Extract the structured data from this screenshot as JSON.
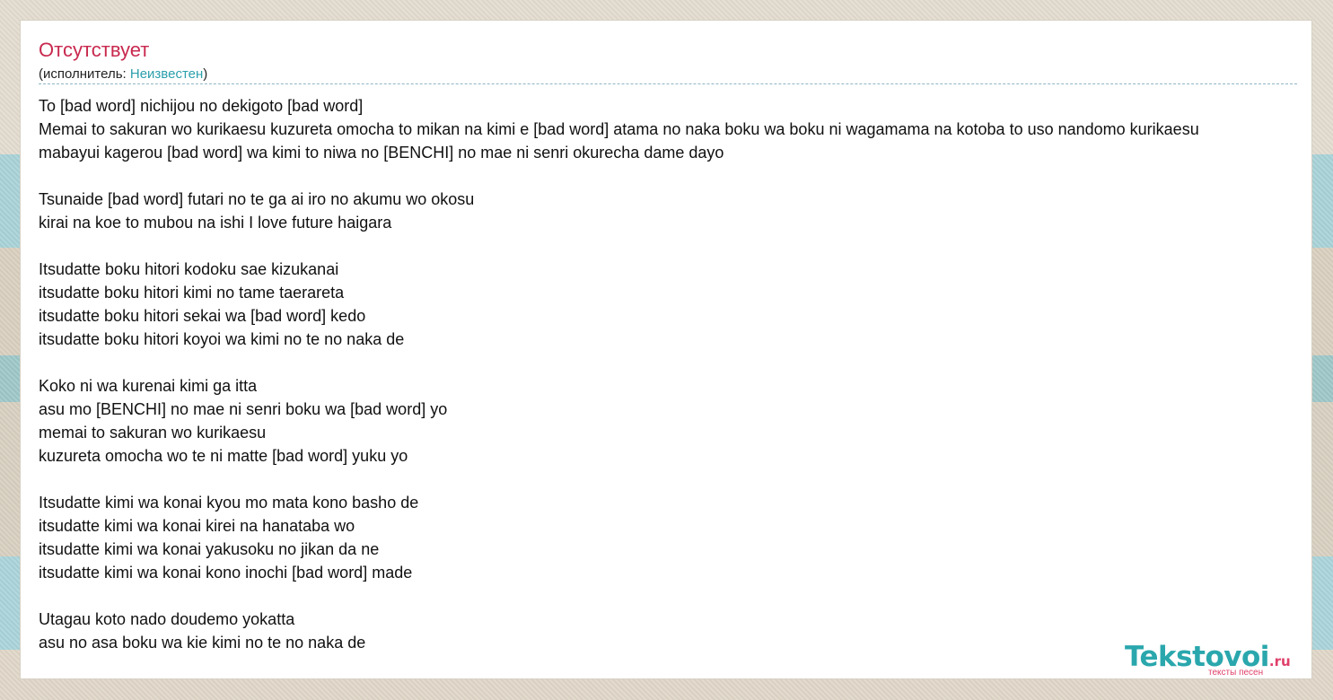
{
  "song": {
    "title": "Отсутствует",
    "artist_prefix": "(исполнитель: ",
    "artist": "Неизвестен",
    "artist_suffix": ")"
  },
  "lyrics": [
    "To [bad word] nichijou no dekigoto [bad word]",
    "Memai to sakuran wo kurikaesu kuzureta omocha to mikan na kimi e [bad word] atama no naka boku wa boku ni wagamama na kotoba to uso nandomo kurikaesu",
    "mabayui kagerou [bad word] wa kimi to niwa no [BENCHI] no mae ni senri okurecha dame dayo",
    "",
    "Tsunaide [bad word] futari no te ga ai iro no akumu wo okosu",
    "kirai na koe to mubou na ishi I love future haigara",
    "",
    "Itsudatte boku hitori kodoku sae kizukanai",
    "itsudatte boku hitori kimi no tame taerareta",
    "itsudatte boku hitori sekai wa [bad word] kedo",
    "itsudatte boku hitori koyoi wa kimi no te no naka de",
    "",
    "Koko ni wa kurenai kimi ga itta",
    "asu mo [BENCHI] no mae ni senri boku wa [bad word] yo",
    "memai to sakuran wo kurikaesu",
    "kuzureta omocha wo te ni matte [bad word] yuku yo",
    "",
    "Itsudatte kimi wa konai kyou mo mata kono basho de",
    "itsudatte kimi wa konai kirei na hanataba wo",
    "itsudatte kimi wa konai yakusoku no jikan da ne",
    "itsudatte kimi wa konai kono inochi [bad word] made",
    "",
    "Utagau koto nado doudemo yokatta",
    "asu no asa boku wa kie kimi no te no naka de"
  ],
  "logo": {
    "main": "Tekstovoi",
    "tld": ".ru",
    "tagline": "тексты песен"
  },
  "colors": {
    "title": "#c8294f",
    "link": "#2a9fab",
    "logo_main": "#2aa7ad",
    "logo_accent": "#e0406a"
  }
}
